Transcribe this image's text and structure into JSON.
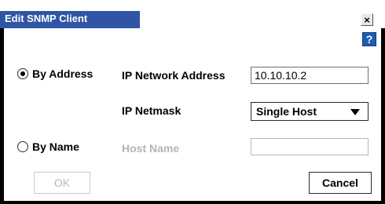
{
  "dialog": {
    "title": "Edit SNMP Client",
    "close_glyph": "×",
    "help_glyph": "?"
  },
  "options": {
    "by_address": {
      "label": "By Address",
      "selected": true
    },
    "by_name": {
      "label": "By Name",
      "selected": false
    }
  },
  "ip_address": {
    "label": "IP Network Address",
    "value": "10.10.10.2"
  },
  "netmask": {
    "label": "IP Netmask",
    "value": "Single Host"
  },
  "host_name": {
    "label": "Host Name",
    "value": ""
  },
  "buttons": {
    "ok": "OK",
    "cancel": "Cancel"
  },
  "colors": {
    "title_bar": "#2f55a4",
    "help_button": "#1d5db2",
    "disabled_text": "#b4b4b4"
  }
}
